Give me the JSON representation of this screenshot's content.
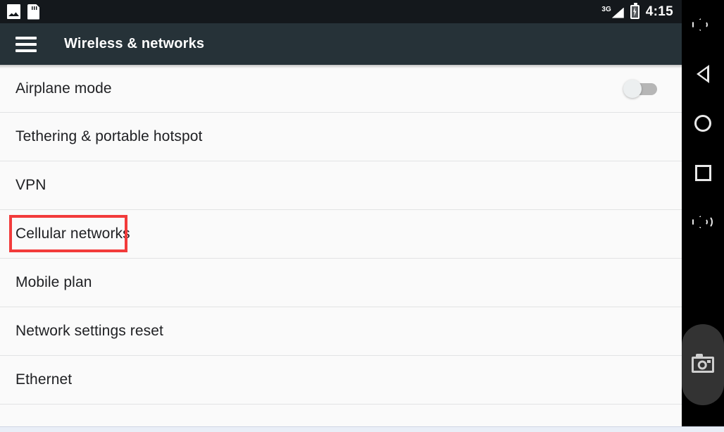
{
  "status_bar": {
    "left_icons": [
      {
        "name": "photo-icon",
        "label": "Screenshot captured"
      },
      {
        "name": "sd-card-icon",
        "label": "SD card"
      }
    ],
    "network_type": "3G",
    "battery_state": "charging",
    "time": "4:15"
  },
  "app_bar": {
    "menu_icon": "hamburger-menu-icon",
    "title": "Wireless & networks"
  },
  "settings": {
    "rows": [
      {
        "label": "Airplane mode",
        "control": "switch",
        "switch_on": false
      },
      {
        "label": "Tethering & portable hotspot",
        "control": "none"
      },
      {
        "label": "VPN",
        "control": "none"
      },
      {
        "label": "Cellular networks",
        "control": "none",
        "highlighted": true
      },
      {
        "label": "Mobile plan",
        "control": "none"
      },
      {
        "label": "Network settings reset",
        "control": "none"
      },
      {
        "label": "Ethernet",
        "control": "none"
      }
    ]
  },
  "annotation": {
    "target": "Cellular networks",
    "color": "#f23b3b"
  },
  "toolbar": {
    "buttons": [
      {
        "name": "volume-up-button",
        "label": "Volume up"
      },
      {
        "name": "back-button",
        "label": "Back"
      },
      {
        "name": "home-button",
        "label": "Home"
      },
      {
        "name": "recents-button",
        "label": "Recent apps"
      },
      {
        "name": "volume-down-button",
        "label": "Volume down"
      },
      {
        "name": "screenshot-button",
        "label": "Take screenshot"
      }
    ]
  },
  "theme": {
    "status_bar_bg": "#14181c",
    "app_bar_bg": "#263238",
    "list_bg": "#fafafa",
    "divider": "#e2e3e4",
    "text_primary": "#202124",
    "accent_red": "#f23b3b",
    "toolbar_bg": "#000000"
  }
}
